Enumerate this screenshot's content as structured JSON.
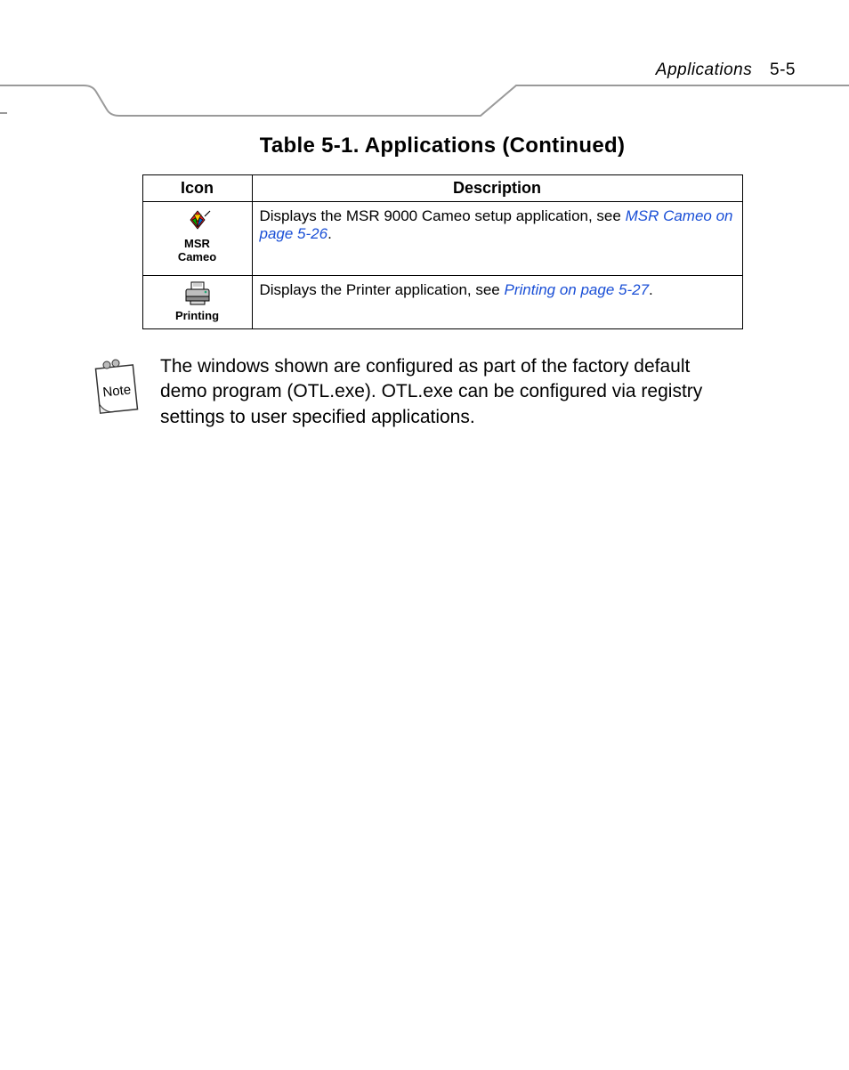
{
  "header": {
    "section_title": "Applications",
    "page_number": "5-5"
  },
  "table": {
    "caption": "Table 5-1. Applications (Continued)",
    "col_icon": "Icon",
    "col_desc": "Description",
    "rows": [
      {
        "icon_name": "msr-cameo-icon",
        "icon_label_line1": "MSR",
        "icon_label_line2": "Cameo",
        "desc_pre": "Displays the MSR 9000 Cameo setup application, see ",
        "desc_link": "MSR Cameo on page 5-26",
        "desc_post": "."
      },
      {
        "icon_name": "printing-icon",
        "icon_label_line1": "Printing",
        "icon_label_line2": "",
        "desc_pre": "Displays the Printer application, see ",
        "desc_link": "Printing on page 5-27",
        "desc_post": "."
      }
    ]
  },
  "note": {
    "label": "Note",
    "text": "The windows shown are configured as part of the factory default demo program (OTL.exe). OTL.exe can be configured via registry settings to user specified applications."
  }
}
